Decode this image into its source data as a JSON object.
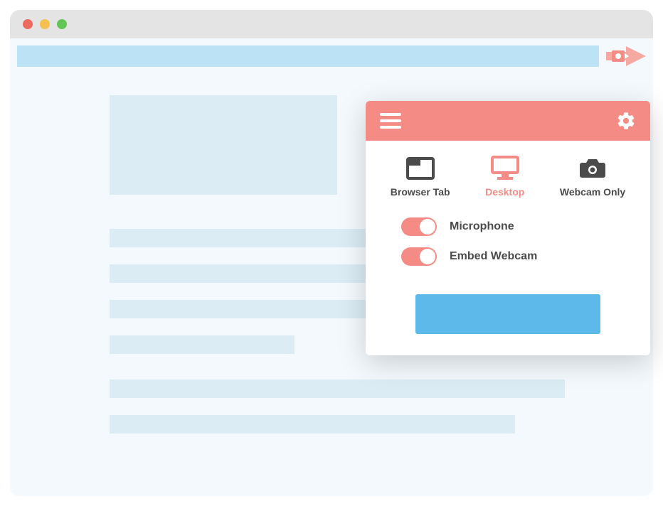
{
  "colors": {
    "accent": "#f58b85",
    "primary_button": "#5cb9ea",
    "skeleton": "#dbecf5",
    "address_bar": "#bbe2f5",
    "titlebar": "#e4e4e4",
    "page_bg": "#f3f9fd",
    "icon_dark": "#4b4b4b"
  },
  "traffic_lights": [
    "close",
    "minimize",
    "zoom"
  ],
  "extension_icon": "screencast-arrow-icon",
  "popup": {
    "header": {
      "menu_icon": "hamburger-icon",
      "settings_icon": "gear-icon"
    },
    "modes": [
      {
        "key": "browser-tab",
        "label": "Browser Tab",
        "icon": "tab-icon",
        "active": false
      },
      {
        "key": "desktop",
        "label": "Desktop",
        "icon": "monitor-icon",
        "active": true
      },
      {
        "key": "webcam-only",
        "label": "Webcam Only",
        "icon": "camera-icon",
        "active": false
      }
    ],
    "toggles": [
      {
        "key": "microphone",
        "label": "Microphone",
        "on": true
      },
      {
        "key": "embed-webcam",
        "label": "Embed Webcam",
        "on": true
      }
    ],
    "record_button_label": ""
  }
}
